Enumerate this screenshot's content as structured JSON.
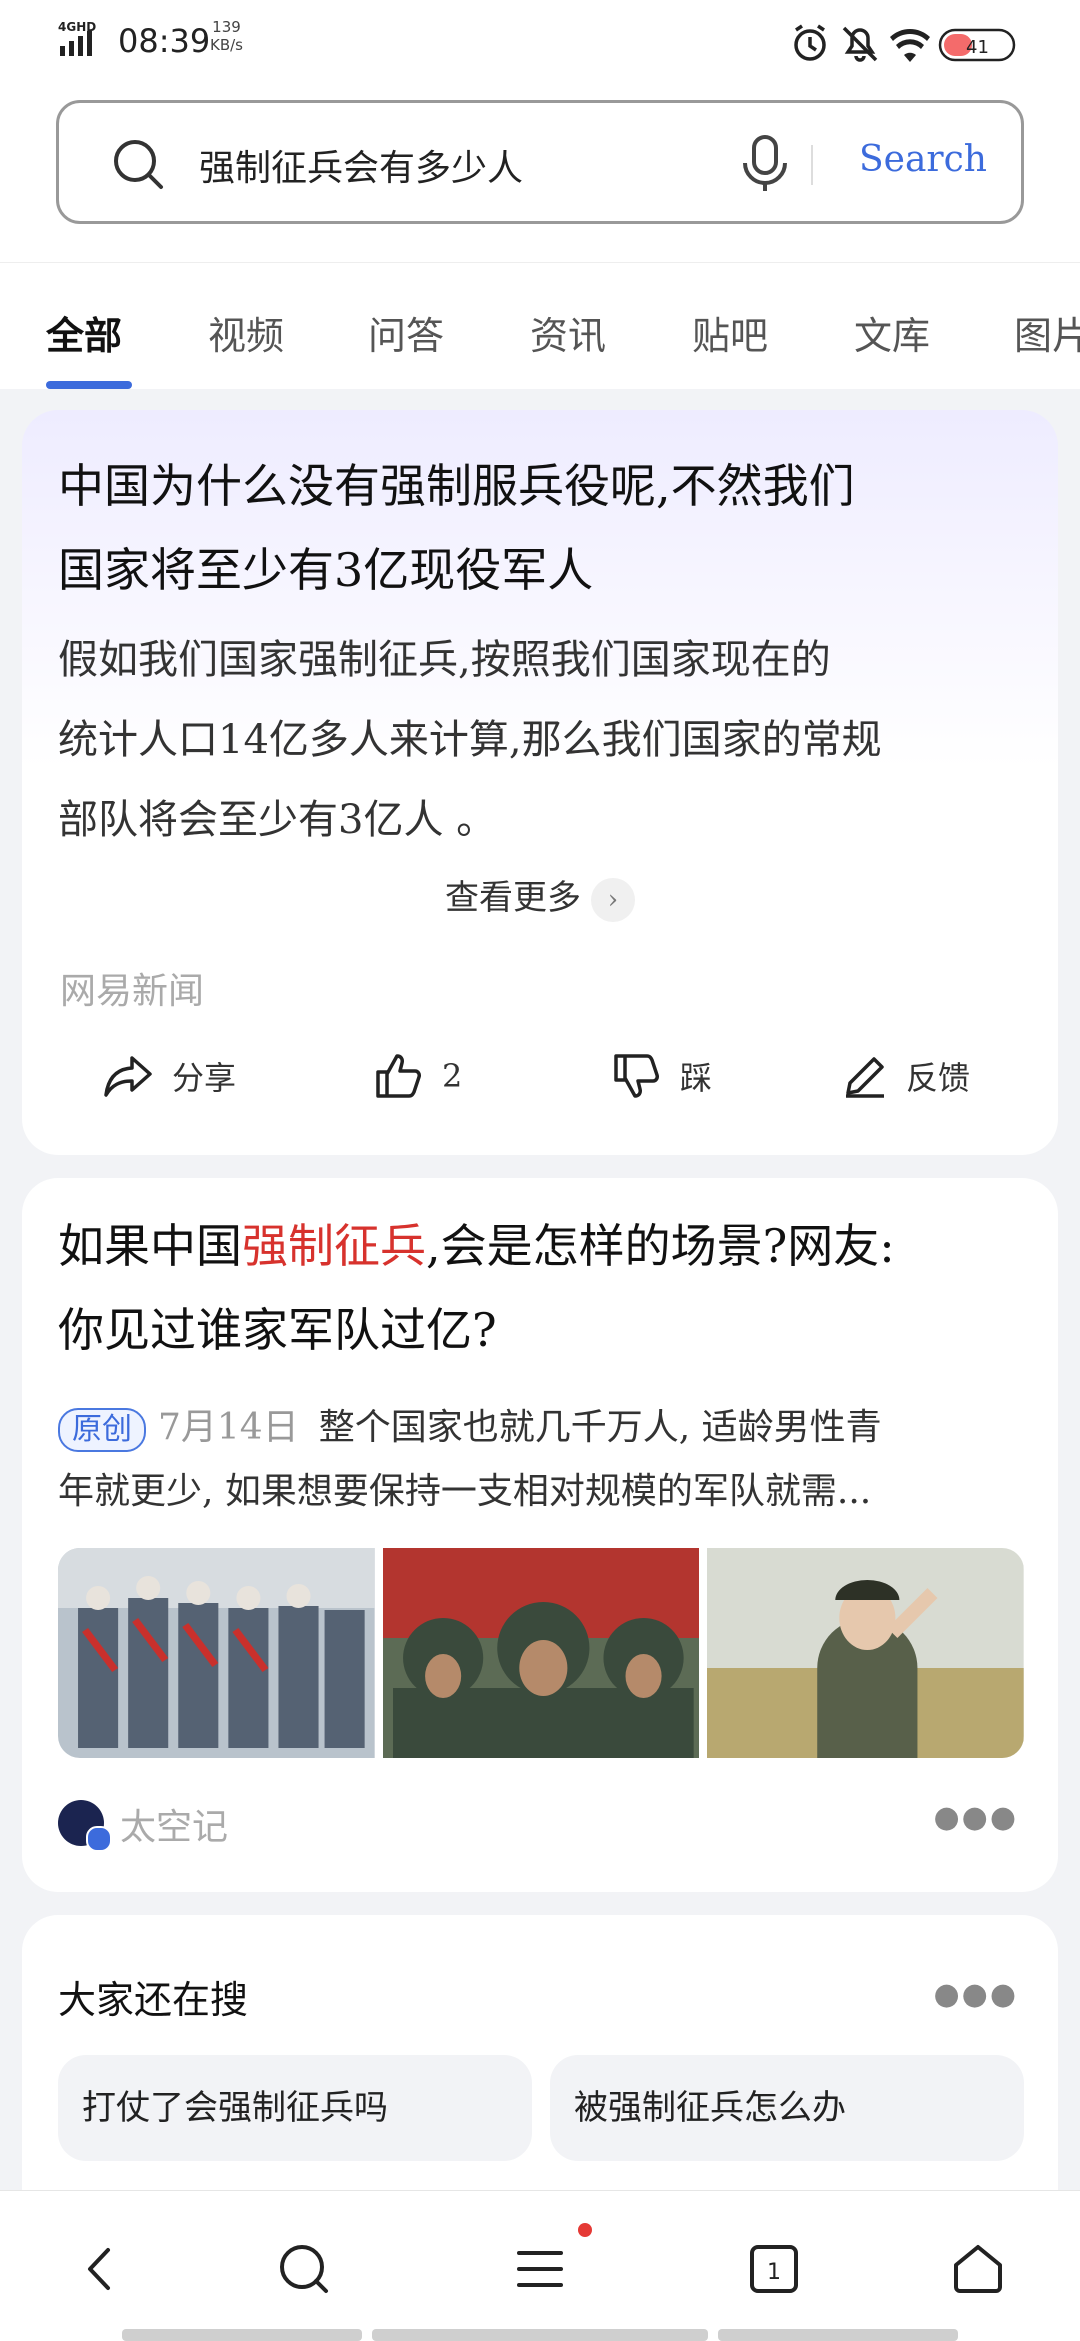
{
  "status": {
    "network": "4GHD",
    "time": "08:39",
    "speed_value": "139",
    "speed_unit": "KB/s",
    "battery": "41"
  },
  "search": {
    "query": "强制征兵会有多少人",
    "button": "Search"
  },
  "tabs": [
    "全部",
    "视频",
    "问答",
    "资讯",
    "贴吧",
    "文库",
    "图片"
  ],
  "card1": {
    "title_line1": "中国为什么没有强制服兵役呢,不然我们",
    "title_line2": "国家将至少有3亿现役军人",
    "body_line1": "假如我们国家强制征兵,按照我们国家现在的",
    "body_line2": "统计人口14亿多人来计算,那么我们国家的常规",
    "body_line3": "部队将会至少有3亿人 。",
    "more": "查看更多",
    "source": "网易新闻",
    "actions": {
      "share": "分享",
      "like": "2",
      "dislike": "踩",
      "feedback": "反馈"
    }
  },
  "card2": {
    "title_pre": "如果中国",
    "title_highlight": "强制征兵",
    "title_post": ",会是怎样的场景?网友:",
    "title_line2": "你见过谁家军队过亿?",
    "badge": "原创",
    "date": "7月14日",
    "snippet1": "整个国家也就几千万人, 适龄男性青",
    "snippet2": "年就更少, 如果想要保持一支相对规模的军队就需...",
    "author": "太空记"
  },
  "related": {
    "title": "大家还在搜",
    "items": [
      "打仗了会强制征兵吗",
      "被强制征兵怎么办"
    ]
  },
  "bottom_nav": {
    "tab_count": "1"
  }
}
